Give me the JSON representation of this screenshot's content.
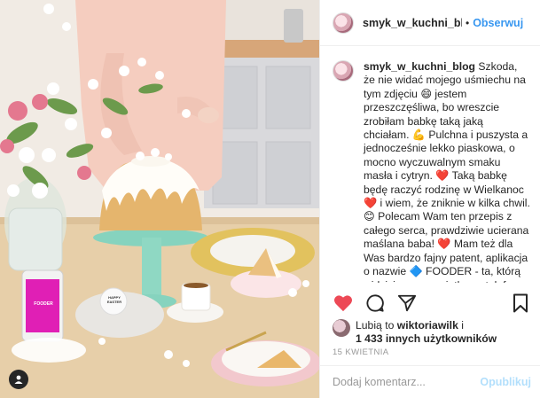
{
  "post": {
    "username": "smyk_w_kuchni_blog",
    "follow_label": "Obserwuj",
    "separator": "•",
    "caption_user": "smyk_w_kuchni_blog",
    "caption_text": "Szkoda, że nie widać mojego uśmiechu na tym zdjęciu 😄 jestem przeszczęśliwa, bo wreszcie zrobiłam babkę taką jaką chciałam. 💪 Pulchna i puszysta a jednocześnie lekko piaskowa, o mocno wyczuwalnym smaku masła i cytryn. ❤️ Taką babkę będę raczyć rodzinę w Wielkanoc ❤️ i wiem, że zniknie w kilka chwil. 😊 Polecam Wam ten przepis z całego serca, prawdziwie ucierana maślana baba! ❤️ Mam też dla Was bardzo fajny patent, aplikacja o nazwie 🔷 FOODER - ta, którą widzicie na wyswietlaczu telefonu na zdjęciu. To narzędzie - bardzo proste w obsłudze- służy do gromadzenia przepisów w tej aplikacji na Waszym",
    "likes_prefix": "Lubią to ",
    "likes_user": "wiktoriawilk",
    "likes_mid": " i",
    "likes_count": "1 433 innych użytkowników",
    "date": "15 KWIETNIA",
    "comment_placeholder": "Dodaj komentarz...",
    "publish_label": "Opublikuj",
    "photo_phone_text": "FOODER",
    "photo_tag_text": "HAPPY EASTER"
  },
  "colors": {
    "accent": "#3897f0",
    "like_red": "#ed4956",
    "publish_disabled": "#b2dffc"
  },
  "icons": {
    "like": "heart-filled-icon",
    "comment": "comment-bubble-icon",
    "share": "share-arrow-icon",
    "save": "bookmark-icon",
    "user_tag": "user-tag-icon"
  }
}
